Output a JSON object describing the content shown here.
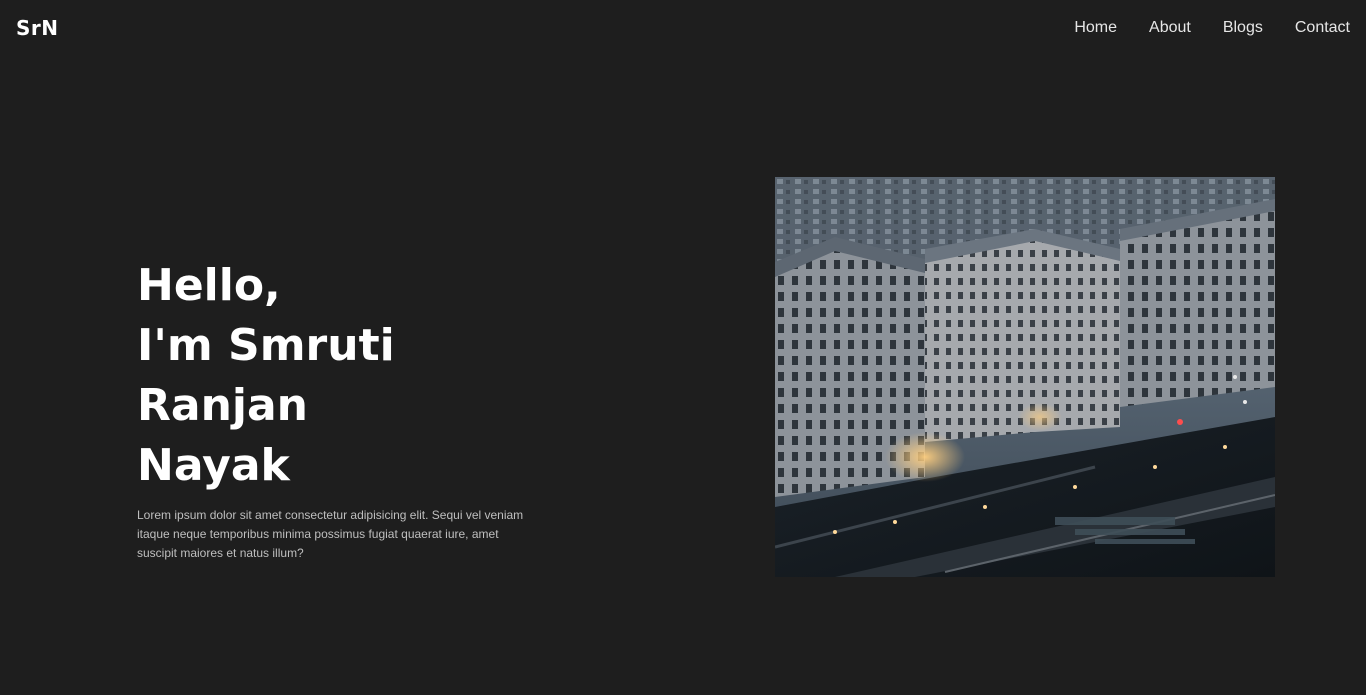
{
  "brand": {
    "logo": "SrN"
  },
  "nav": {
    "items": [
      {
        "label": "Home"
      },
      {
        "label": "About"
      },
      {
        "label": "Blogs"
      },
      {
        "label": "Contact"
      }
    ]
  },
  "hero": {
    "greeting": "Hello,",
    "intro": "I'm Smruti Ranjan",
    "surname": "Nayak",
    "description": "Lorem ipsum dolor sit amet consectetur adipisicing elit. Sequi vel veniam itaque neque temporibus minima possimus fugiat quaerat iure, amet suscipit maiores et natus illum?"
  },
  "colors": {
    "background": "#1e1e1e",
    "text": "#ffffff",
    "muted_text": "#bfbfbf"
  }
}
